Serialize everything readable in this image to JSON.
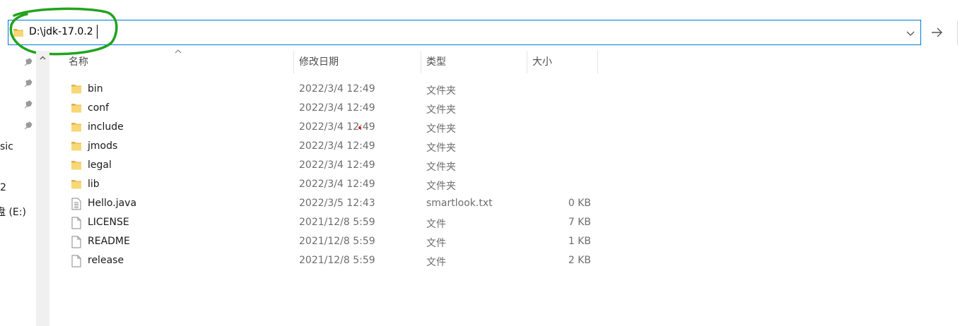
{
  "address_bar": {
    "path": "D:\\jdk-17.0.2"
  },
  "nav_pane": {
    "partial_labels": [
      "sic",
      "2",
      "盘 (E:)"
    ]
  },
  "columns": {
    "name": "名称",
    "modified": "修改日期",
    "type": "类型",
    "size": "大小"
  },
  "files": [
    {
      "name": "bin",
      "modified": "2022/3/4 12:49",
      "type": "文件夹",
      "size": "",
      "icon": "folder-icon"
    },
    {
      "name": "conf",
      "modified": "2022/3/4 12:49",
      "type": "文件夹",
      "size": "",
      "icon": "folder-icon"
    },
    {
      "name": "include",
      "modified": "2022/3/4 12:49",
      "type": "文件夹",
      "size": "",
      "icon": "folder-icon"
    },
    {
      "name": "jmods",
      "modified": "2022/3/4 12:49",
      "type": "文件夹",
      "size": "",
      "icon": "folder-icon"
    },
    {
      "name": "legal",
      "modified": "2022/3/4 12:49",
      "type": "文件夹",
      "size": "",
      "icon": "folder-icon"
    },
    {
      "name": "lib",
      "modified": "2022/3/4 12:49",
      "type": "文件夹",
      "size": "",
      "icon": "folder-icon"
    },
    {
      "name": "Hello.java",
      "modified": "2022/3/5 12:43",
      "type": "smartlook.txt",
      "size": "0 KB",
      "icon": "text-file-icon"
    },
    {
      "name": "LICENSE",
      "modified": "2021/12/8 5:59",
      "type": "文件",
      "size": "7 KB",
      "icon": "file-icon"
    },
    {
      "name": "README",
      "modified": "2021/12/8 5:59",
      "type": "文件",
      "size": "1 KB",
      "icon": "file-icon"
    },
    {
      "name": "release",
      "modified": "2021/12/8 5:59",
      "type": "文件",
      "size": "2 KB",
      "icon": "file-icon"
    }
  ],
  "colors": {
    "address_border": "#0078d7",
    "folder": "#f8d775",
    "annotation": "#22a31e"
  }
}
